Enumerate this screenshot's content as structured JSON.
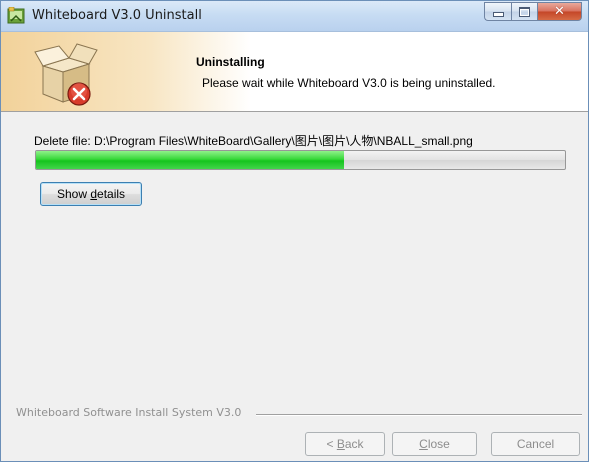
{
  "window": {
    "title": "Whiteboard V3.0 Uninstall",
    "app_icon": "whiteboard-app-icon"
  },
  "caption_buttons": {
    "minimize_icon": "minimize-icon",
    "maximize_icon": "maximize-icon",
    "close_glyph": "✕"
  },
  "header": {
    "title": "Uninstalling",
    "subtitle": "Please wait while Whiteboard V3.0 is being uninstalled.",
    "icon": "uninstall-box-icon"
  },
  "status": {
    "text": "Delete file: D:\\Program Files\\WhiteBoard\\Gallery\\图片\\图片\\人物\\NBALL_small.png"
  },
  "progress": {
    "fraction": 0.582
  },
  "buttons": {
    "show_details": {
      "pre": "Show ",
      "mnemonic": "d",
      "post": "etails"
    },
    "back": {
      "pre": "< ",
      "mnemonic": "B",
      "post": "ack"
    },
    "close": {
      "pre": "",
      "mnemonic": "C",
      "post": "lose"
    },
    "cancel": "Cancel"
  },
  "footer": {
    "brand": "Whiteboard Software Install System V3.0"
  },
  "colors": {
    "progress_fill": "#22c82a",
    "header_accent": "#f2d29a",
    "close_button": "#c44628"
  }
}
